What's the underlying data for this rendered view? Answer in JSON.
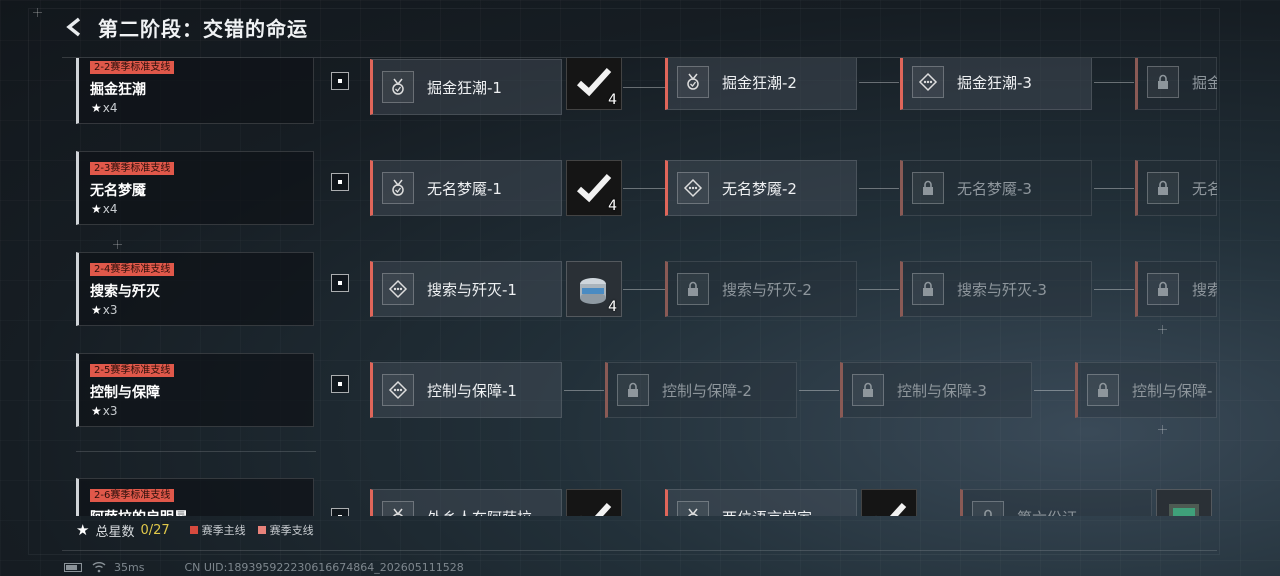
{
  "header": {
    "title": "第二阶段：交错的命运"
  },
  "chapters": [
    {
      "tag": "2-2赛季标准支线",
      "name": "掘金狂潮",
      "stars": "x4",
      "stages": [
        {
          "label": "掘金狂潮-1",
          "icon": "medal-icon",
          "locked": false,
          "reward": {
            "type": "claimed",
            "count": "4"
          }
        },
        {
          "label": "掘金狂潮-2",
          "icon": "medal-icon",
          "locked": false
        },
        {
          "label": "掘金狂潮-3",
          "icon": "diamond-dots-icon",
          "locked": false
        },
        {
          "label": "掘金",
          "icon": "lock-icon",
          "locked": true
        }
      ]
    },
    {
      "tag": "2-3赛季标准支线",
      "name": "无名梦魇",
      "stars": "x4",
      "stages": [
        {
          "label": "无名梦魇-1",
          "icon": "medal-icon",
          "locked": false,
          "reward": {
            "type": "claimed",
            "count": "4"
          }
        },
        {
          "label": "无名梦魇-2",
          "icon": "diamond-dots-icon",
          "locked": false
        },
        {
          "label": "无名梦魇-3",
          "icon": "lock-icon",
          "locked": true
        },
        {
          "label": "无名",
          "icon": "lock-icon",
          "locked": true
        }
      ]
    },
    {
      "tag": "2-4赛季标准支线",
      "name": "搜索与歼灭",
      "stars": "x3",
      "stages": [
        {
          "label": "搜索与歼灭-1",
          "icon": "diamond-dots-icon",
          "locked": false,
          "reward": {
            "type": "can",
            "count": "4"
          }
        },
        {
          "label": "搜索与歼灭-2",
          "icon": "lock-icon",
          "locked": true
        },
        {
          "label": "搜索与歼灭-3",
          "icon": "lock-icon",
          "locked": true
        },
        {
          "label": "搜索",
          "icon": "lock-icon",
          "locked": true
        }
      ]
    },
    {
      "tag": "2-5赛季标准支线",
      "name": "控制与保障",
      "stars": "x3",
      "stages": [
        {
          "label": "控制与保障-1",
          "icon": "diamond-dots-icon",
          "locked": false
        },
        {
          "label": "控制与保障-2",
          "icon": "lock-icon",
          "locked": true
        },
        {
          "label": "控制与保障-3",
          "icon": "lock-icon",
          "locked": true
        },
        {
          "label": "控制与保障-",
          "icon": "lock-icon",
          "locked": true
        }
      ]
    },
    {
      "tag": "2-6赛季标准支线",
      "name": "阿萨拉的启明星",
      "stars": "",
      "stages": [
        {
          "label": "外乡人在阿萨拉",
          "icon": "medal-icon",
          "locked": false
        },
        {
          "label": "两位语言学家",
          "icon": "medal-icon",
          "locked": false
        },
        {
          "label": "第六份证",
          "icon": "lock-icon",
          "locked": true
        }
      ]
    }
  ],
  "footer": {
    "star_label": "总星数",
    "star_value": "0/27",
    "legend_main": "赛季主线",
    "legend_side": "赛季支线",
    "legend_main_color": "#d64a3e",
    "legend_side_color": "#e8827a"
  },
  "status": {
    "ping": "35ms",
    "uid": "CN UID:1893959222306166748​64_202605111528"
  }
}
